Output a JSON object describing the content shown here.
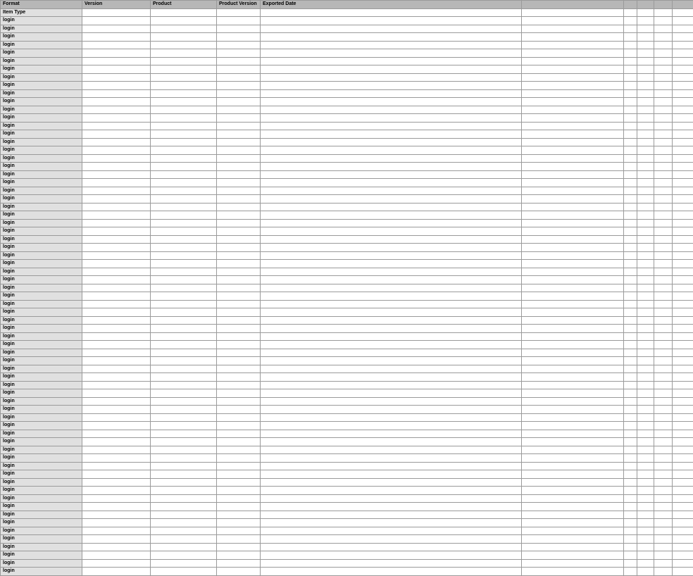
{
  "columns": [
    {
      "key": "format",
      "label": "Format"
    },
    {
      "key": "version",
      "label": "Version"
    },
    {
      "key": "product",
      "label": "Product"
    },
    {
      "key": "product_version",
      "label": "Product Version"
    },
    {
      "key": "exported_date",
      "label": "Exported Date"
    },
    {
      "key": "c5",
      "label": ""
    },
    {
      "key": "c6",
      "label": ""
    },
    {
      "key": "c7",
      "label": ""
    },
    {
      "key": "c8",
      "label": ""
    },
    {
      "key": "c9",
      "label": ""
    }
  ],
  "rows": [
    {
      "label": "Item Type",
      "cells": [
        "",
        "",
        "",
        "",
        "",
        "",
        "",
        "",
        ""
      ]
    },
    {
      "label": "login",
      "cells": [
        "",
        "",
        "",
        "",
        "",
        "",
        "",
        "",
        ""
      ]
    },
    {
      "label": "login",
      "cells": [
        "",
        "",
        "",
        "",
        "",
        "",
        "",
        "",
        ""
      ]
    },
    {
      "label": "login",
      "cells": [
        "",
        "",
        "",
        "",
        "",
        "",
        "",
        "",
        ""
      ]
    },
    {
      "label": "login",
      "cells": [
        "",
        "",
        "",
        "",
        "",
        "",
        "",
        "",
        ""
      ]
    },
    {
      "label": "login",
      "cells": [
        "",
        "",
        "",
        "",
        "",
        "",
        "",
        "",
        ""
      ]
    },
    {
      "label": "login",
      "cells": [
        "",
        "",
        "",
        "",
        "",
        "",
        "",
        "",
        ""
      ]
    },
    {
      "label": "login",
      "cells": [
        "",
        "",
        "",
        "",
        "",
        "",
        "",
        "",
        ""
      ]
    },
    {
      "label": "login",
      "cells": [
        "",
        "",
        "",
        "",
        "",
        "",
        "",
        "",
        ""
      ]
    },
    {
      "label": "login",
      "cells": [
        "",
        "",
        "",
        "",
        "",
        "",
        "",
        "",
        ""
      ]
    },
    {
      "label": "login",
      "cells": [
        "",
        "",
        "",
        "",
        "",
        "",
        "",
        "",
        ""
      ]
    },
    {
      "label": "login",
      "cells": [
        "",
        "",
        "",
        "",
        "",
        "",
        "",
        "",
        ""
      ]
    },
    {
      "label": "login",
      "cells": [
        "",
        "",
        "",
        "",
        "",
        "",
        "",
        "",
        ""
      ]
    },
    {
      "label": "login",
      "cells": [
        "",
        "",
        "",
        "",
        "",
        "",
        "",
        "",
        ""
      ]
    },
    {
      "label": "login",
      "cells": [
        "",
        "",
        "",
        "",
        "",
        "",
        "",
        "",
        ""
      ]
    },
    {
      "label": "login",
      "cells": [
        "",
        "",
        "",
        "",
        "",
        "",
        "",
        "",
        ""
      ]
    },
    {
      "label": "login",
      "cells": [
        "",
        "",
        "",
        "",
        "",
        "",
        "",
        "",
        ""
      ]
    },
    {
      "label": "login",
      "cells": [
        "",
        "",
        "",
        "",
        "",
        "",
        "",
        "",
        ""
      ]
    },
    {
      "label": "login",
      "cells": [
        "",
        "",
        "",
        "",
        "",
        "",
        "",
        "",
        ""
      ]
    },
    {
      "label": "login",
      "cells": [
        "",
        "",
        "",
        "",
        "",
        "",
        "",
        "",
        ""
      ]
    },
    {
      "label": "login",
      "cells": [
        "",
        "",
        "",
        "",
        "",
        "",
        "",
        "",
        ""
      ]
    },
    {
      "label": "login",
      "cells": [
        "",
        "",
        "",
        "",
        "",
        "",
        "",
        "",
        ""
      ]
    },
    {
      "label": "login",
      "cells": [
        "",
        "",
        "",
        "",
        "",
        "",
        "",
        "",
        ""
      ]
    },
    {
      "label": "login",
      "cells": [
        "",
        "",
        "",
        "",
        "",
        "",
        "",
        "",
        ""
      ]
    },
    {
      "label": "login",
      "cells": [
        "",
        "",
        "",
        "",
        "",
        "",
        "",
        "",
        ""
      ]
    },
    {
      "label": "login",
      "cells": [
        "",
        "",
        "",
        "",
        "",
        "",
        "",
        "",
        ""
      ]
    },
    {
      "label": "login",
      "cells": [
        "",
        "",
        "",
        "",
        "",
        "",
        "",
        "",
        ""
      ]
    },
    {
      "label": "login",
      "cells": [
        "",
        "",
        "",
        "",
        "",
        "",
        "",
        "",
        ""
      ]
    },
    {
      "label": "login",
      "cells": [
        "",
        "",
        "",
        "",
        "",
        "",
        "",
        "",
        ""
      ]
    },
    {
      "label": "login",
      "cells": [
        "",
        "",
        "",
        "",
        "",
        "",
        "",
        "",
        ""
      ]
    },
    {
      "label": "login",
      "cells": [
        "",
        "",
        "",
        "",
        "",
        "",
        "",
        "",
        ""
      ]
    },
    {
      "label": "login",
      "cells": [
        "",
        "",
        "",
        "",
        "",
        "",
        "",
        "",
        ""
      ]
    },
    {
      "label": "login",
      "cells": [
        "",
        "",
        "",
        "",
        "",
        "",
        "",
        "",
        ""
      ]
    },
    {
      "label": "login",
      "cells": [
        "",
        "",
        "",
        "",
        "",
        "",
        "",
        "",
        ""
      ]
    },
    {
      "label": "login",
      "cells": [
        "",
        "",
        "",
        "",
        "",
        "",
        "",
        "",
        ""
      ]
    },
    {
      "label": "login",
      "cells": [
        "",
        "",
        "",
        "",
        "",
        "",
        "",
        "",
        ""
      ]
    },
    {
      "label": "login",
      "cells": [
        "",
        "",
        "",
        "",
        "",
        "",
        "",
        "",
        ""
      ]
    },
    {
      "label": "login",
      "cells": [
        "",
        "",
        "",
        "",
        "",
        "",
        "",
        "",
        ""
      ]
    },
    {
      "label": "login",
      "cells": [
        "",
        "",
        "",
        "",
        "",
        "",
        "",
        "",
        ""
      ]
    },
    {
      "label": "login",
      "cells": [
        "",
        "",
        "",
        "",
        "",
        "",
        "",
        "",
        ""
      ]
    },
    {
      "label": "login",
      "cells": [
        "",
        "",
        "",
        "",
        "",
        "",
        "",
        "",
        ""
      ]
    },
    {
      "label": "login",
      "cells": [
        "",
        "",
        "",
        "",
        "",
        "",
        "",
        "",
        ""
      ]
    },
    {
      "label": "login",
      "cells": [
        "",
        "",
        "",
        "",
        "",
        "",
        "",
        "",
        ""
      ]
    },
    {
      "label": "login",
      "cells": [
        "",
        "",
        "",
        "",
        "",
        "",
        "",
        "",
        ""
      ]
    },
    {
      "label": "login",
      "cells": [
        "",
        "",
        "",
        "",
        "",
        "",
        "",
        "",
        ""
      ]
    },
    {
      "label": "login",
      "cells": [
        "",
        "",
        "",
        "",
        "",
        "",
        "",
        "",
        ""
      ]
    },
    {
      "label": "login",
      "cells": [
        "",
        "",
        "",
        "",
        "",
        "",
        "",
        "",
        ""
      ]
    },
    {
      "label": "login",
      "cells": [
        "",
        "",
        "",
        "",
        "",
        "",
        "",
        "",
        ""
      ]
    },
    {
      "label": "login",
      "cells": [
        "",
        "",
        "",
        "",
        "",
        "",
        "",
        "",
        ""
      ]
    },
    {
      "label": "login",
      "cells": [
        "",
        "",
        "",
        "",
        "",
        "",
        "",
        "",
        ""
      ]
    },
    {
      "label": "login",
      "cells": [
        "",
        "",
        "",
        "",
        "",
        "",
        "",
        "",
        ""
      ]
    },
    {
      "label": "login",
      "cells": [
        "",
        "",
        "",
        "",
        "",
        "",
        "",
        "",
        ""
      ]
    },
    {
      "label": "login",
      "cells": [
        "",
        "",
        "",
        "",
        "",
        "",
        "",
        "",
        ""
      ]
    },
    {
      "label": "login",
      "cells": [
        "",
        "",
        "",
        "",
        "",
        "",
        "",
        "",
        ""
      ]
    },
    {
      "label": "login",
      "cells": [
        "",
        "",
        "",
        "",
        "",
        "",
        "",
        "",
        ""
      ]
    },
    {
      "label": "login",
      "cells": [
        "",
        "",
        "",
        "",
        "",
        "",
        "",
        "",
        ""
      ]
    },
    {
      "label": "login",
      "cells": [
        "",
        "",
        "",
        "",
        "",
        "",
        "",
        "",
        ""
      ]
    },
    {
      "label": "login",
      "cells": [
        "",
        "",
        "",
        "",
        "",
        "",
        "",
        "",
        ""
      ]
    },
    {
      "label": "login",
      "cells": [
        "",
        "",
        "",
        "",
        "",
        "",
        "",
        "",
        ""
      ]
    },
    {
      "label": "login",
      "cells": [
        "",
        "",
        "",
        "",
        "",
        "",
        "",
        "",
        ""
      ]
    },
    {
      "label": "login",
      "cells": [
        "",
        "",
        "",
        "",
        "",
        "",
        "",
        "",
        ""
      ]
    },
    {
      "label": "login",
      "cells": [
        "",
        "",
        "",
        "",
        "",
        "",
        "",
        "",
        ""
      ]
    },
    {
      "label": "login",
      "cells": [
        "",
        "",
        "",
        "",
        "",
        "",
        "",
        "",
        ""
      ]
    },
    {
      "label": "login",
      "cells": [
        "",
        "",
        "",
        "",
        "",
        "",
        "",
        "",
        ""
      ]
    },
    {
      "label": "login",
      "cells": [
        "",
        "",
        "",
        "",
        "",
        "",
        "",
        "",
        ""
      ]
    },
    {
      "label": "login",
      "cells": [
        "",
        "",
        "",
        "",
        "",
        "",
        "",
        "",
        ""
      ]
    },
    {
      "label": "login",
      "cells": [
        "",
        "",
        "",
        "",
        "",
        "",
        "",
        "",
        ""
      ]
    },
    {
      "label": "login",
      "cells": [
        "",
        "",
        "",
        "",
        "",
        "",
        "",
        "",
        ""
      ]
    },
    {
      "label": "login",
      "cells": [
        "",
        "",
        "",
        "",
        "",
        "",
        "",
        "",
        ""
      ]
    },
    {
      "label": "login",
      "cells": [
        "",
        "",
        "",
        "",
        "",
        "",
        "",
        "",
        ""
      ]
    }
  ]
}
